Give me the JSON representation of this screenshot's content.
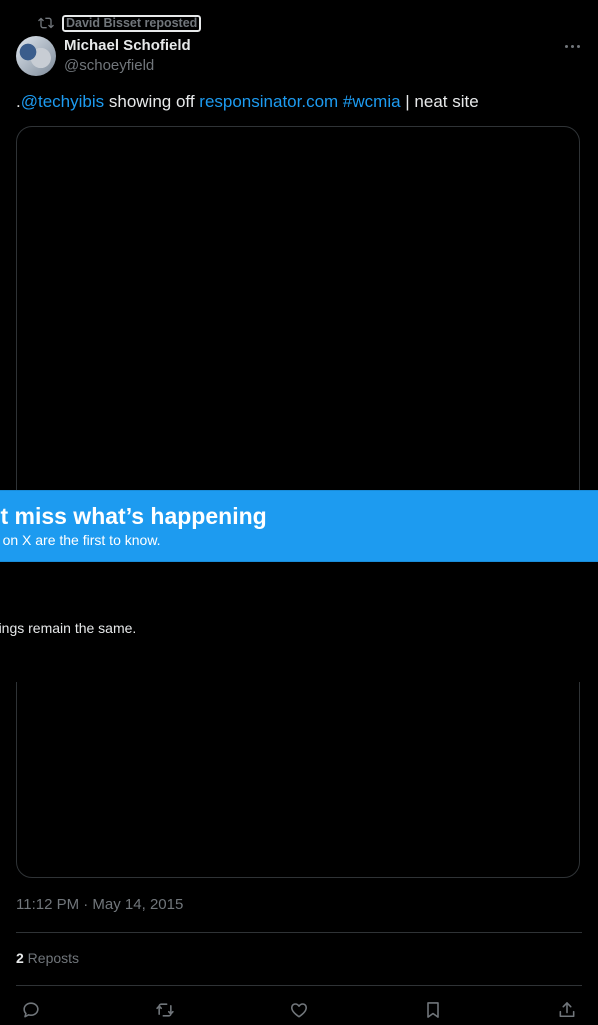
{
  "repost": {
    "icon": "repost-icon",
    "label": "David Bisset reposted"
  },
  "author": {
    "name": "Michael Schofield",
    "handle": "@schoeyfield",
    "avatar": "avatar-photo"
  },
  "tweet": {
    "prefix": ".",
    "mention": "@techyibis",
    "middle": " showing off ",
    "link": "responsinator.com",
    "space": " ",
    "hashtag": "#wcmia",
    "suffix": " | neat site"
  },
  "banner": {
    "title": "n’t miss what’s happening",
    "subtitle": "ple on X are the first to know."
  },
  "overlay": {
    "text": "settings remain the same."
  },
  "meta": {
    "timestamp": "11:12 PM · May 14, 2015"
  },
  "stats": {
    "reposts_count": "2",
    "reposts_label": " Reposts"
  },
  "actions": [
    "reply-icon",
    "repost-icon",
    "like-icon",
    "bookmark-icon",
    "share-icon"
  ],
  "colors": {
    "accent": "#1d9bf0",
    "background": "#000000",
    "muted": "#71767b",
    "text": "#e7e9ea"
  }
}
